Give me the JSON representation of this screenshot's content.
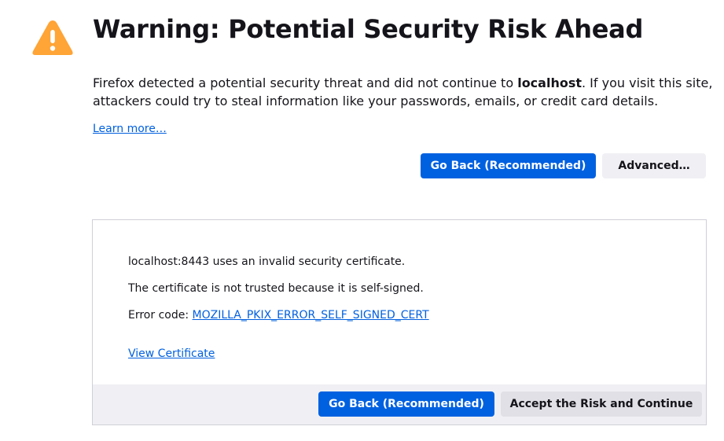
{
  "icons": {
    "warning": "warning-triangle-icon"
  },
  "colors": {
    "accent": "#0061e0",
    "warning": "#ffa436",
    "link": "#0060df"
  },
  "header": {
    "title": "Warning: Potential Security Risk Ahead"
  },
  "intro": {
    "text_before": "Firefox detected a potential security threat and did not continue to ",
    "host": "localhost",
    "text_after": ". If you visit this site, attackers could try to steal information like your passwords, emails, or credit card details."
  },
  "learn_more": "Learn more…",
  "buttons": {
    "go_back": "Go Back (Recommended)",
    "advanced": "Advanced…"
  },
  "advanced_panel": {
    "invalid_cert": "localhost:8443 uses an invalid security certificate.",
    "reason": "The certificate is not trusted because it is self-signed.",
    "error_code_label": "Error code: ",
    "error_code": "MOZILLA_PKIX_ERROR_SELF_SIGNED_CERT",
    "view_certificate": "View Certificate",
    "go_back": "Go Back (Recommended)",
    "accept_risk": "Accept the Risk and Continue"
  }
}
